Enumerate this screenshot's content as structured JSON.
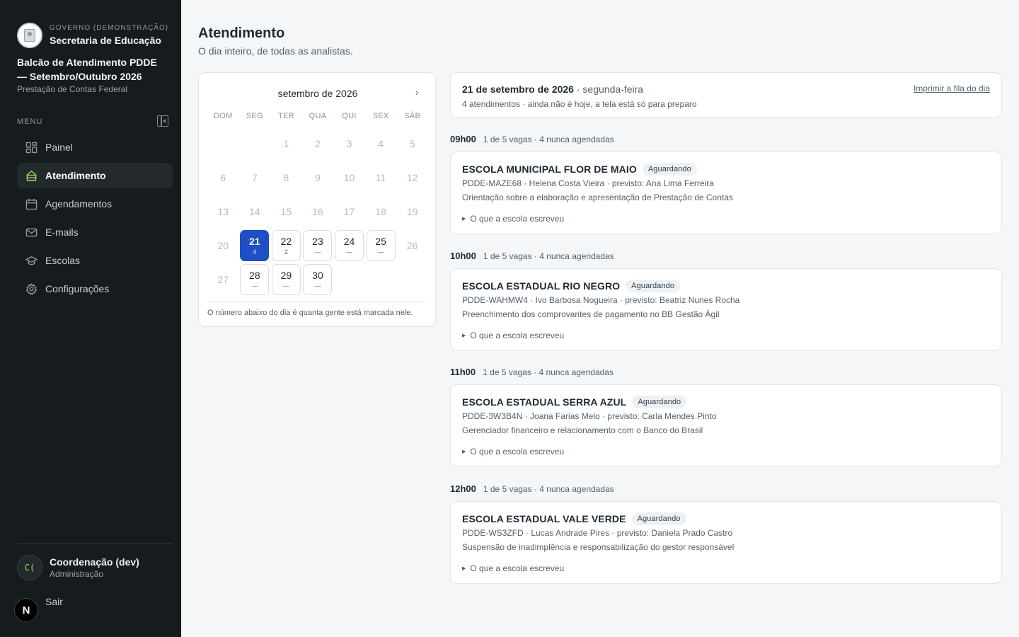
{
  "sidebar": {
    "gov_label": "GOVERNO (DEMONSTRAÇÃO)",
    "org_name": "Secretaria de Educação",
    "project_title": "Balcão de Atendimento PDDE — Setembro/Outubro 2026",
    "project_subtitle": "Prestação de Contas Federal",
    "menu_label": "MENU",
    "items": [
      {
        "label": "Painel",
        "icon": "dashboard-icon"
      },
      {
        "label": "Atendimento",
        "icon": "desk-icon",
        "active": true
      },
      {
        "label": "Agendamentos",
        "icon": "calendar-icon"
      },
      {
        "label": "E-mails",
        "icon": "mail-icon"
      },
      {
        "label": "Escolas",
        "icon": "graduation-cap-icon"
      },
      {
        "label": "Configurações",
        "icon": "gear-icon"
      }
    ],
    "user": {
      "initials": "C(",
      "name": "Coordenação (dev)",
      "role": "Administração"
    },
    "logout_label": "Sair",
    "dev_badge": "N"
  },
  "main": {
    "title": "Atendimento",
    "subtitle": "O dia inteiro, de todas as analistas."
  },
  "calendar": {
    "month_label": "setembro de 2026",
    "next_label": "›",
    "weekdays": [
      "DOM",
      "SEG",
      "TER",
      "QUA",
      "QUI",
      "SEX",
      "SÁB"
    ],
    "weeks": [
      [
        {
          "d": ""
        },
        {
          "d": ""
        },
        {
          "d": "1"
        },
        {
          "d": "2"
        },
        {
          "d": "3"
        },
        {
          "d": "4"
        },
        {
          "d": "5"
        }
      ],
      [
        {
          "d": "6"
        },
        {
          "d": "7"
        },
        {
          "d": "8"
        },
        {
          "d": "9"
        },
        {
          "d": "10"
        },
        {
          "d": "11"
        },
        {
          "d": "12"
        }
      ],
      [
        {
          "d": "13"
        },
        {
          "d": "14"
        },
        {
          "d": "15"
        },
        {
          "d": "16"
        },
        {
          "d": "17"
        },
        {
          "d": "18"
        },
        {
          "d": "19"
        }
      ],
      [
        {
          "d": "20"
        },
        {
          "d": "21",
          "count": "4",
          "state": "sel"
        },
        {
          "d": "22",
          "count": "2",
          "state": "avail"
        },
        {
          "d": "23",
          "count": "—",
          "state": "avail"
        },
        {
          "d": "24",
          "count": "—",
          "state": "avail"
        },
        {
          "d": "25",
          "count": "—",
          "state": "avail"
        },
        {
          "d": "26"
        }
      ],
      [
        {
          "d": "27"
        },
        {
          "d": "28",
          "count": "—",
          "state": "avail"
        },
        {
          "d": "29",
          "count": "—",
          "state": "avail"
        },
        {
          "d": "30",
          "count": "—",
          "state": "avail"
        },
        {
          "d": ""
        },
        {
          "d": ""
        },
        {
          "d": ""
        }
      ]
    ],
    "note": "O número abaixo do dia é quanta gente está marcada nele."
  },
  "day": {
    "date": "21 de setembro de 2026",
    "weekday": "· segunda-feira",
    "summary": "4 atendimentos · ainda não é hoje, a tela está só para preparo",
    "print_label": "Imprimir a fila do dia"
  },
  "slots": [
    {
      "time": "09h00",
      "capacity": "1 de 5 vagas · 4 nunca agendadas",
      "school": "ESCOLA MUNICIPAL FLOR DE MAIO",
      "status": "Aguardando",
      "meta": "PDDE-MAZE68 · Helena Costa Vieira · previsto: Ana Lima Ferreira",
      "topic": "Orientação sobre a elaboração e apresentação de Prestação de Contas",
      "more": "O que a escola escreveu"
    },
    {
      "time": "10h00",
      "capacity": "1 de 5 vagas · 4 nunca agendadas",
      "school": "ESCOLA ESTADUAL RIO NEGRO",
      "status": "Aguardando",
      "meta": "PDDE-WAHMW4 · Ivo Barbosa Nogueira · previsto: Beatriz Nunes Rocha",
      "topic": "Preenchimento dos comprovantes de pagamento no BB Gestão Ágil",
      "more": "O que a escola escreveu"
    },
    {
      "time": "11h00",
      "capacity": "1 de 5 vagas · 4 nunca agendadas",
      "school": "ESCOLA ESTADUAL SERRA AZUL",
      "status": "Aguardando",
      "meta": "PDDE-3W3B4N · Joana Farias Melo · previsto: Carla Mendes Pinto",
      "topic": "Gerenciador financeiro e relacionamento com o Banco do Brasil",
      "more": "O que a escola escreveu"
    },
    {
      "time": "12h00",
      "capacity": "1 de 5 vagas · 4 nunca agendadas",
      "school": "ESCOLA ESTADUAL VALE VERDE",
      "status": "Aguardando",
      "meta": "PDDE-WS3ZFD · Lucas Andrade Pires · previsto: Daniela Prado Castro",
      "topic": "Suspensão de inadimplência e responsabilização do gestor responsável",
      "more": "O que a escola escreveu"
    }
  ],
  "colors": {
    "sidebar_bg": "#161b1e",
    "accent": "#1e4fc4",
    "active_icon": "#9be15d"
  }
}
